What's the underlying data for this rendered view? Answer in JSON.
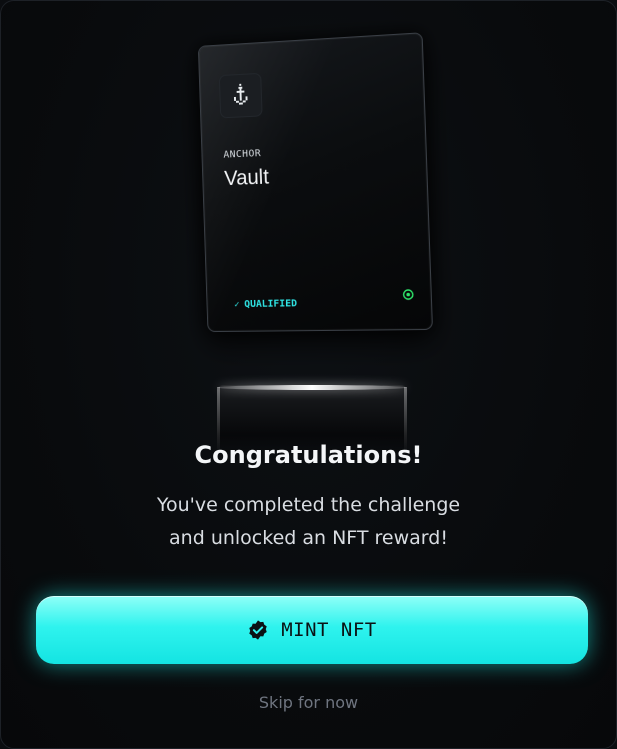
{
  "nft_card": {
    "subtitle": "ANCHOR",
    "title": "Vault",
    "status_check": "✓",
    "status_label": "QUALIFIED",
    "icon": "anchor-icon",
    "status_dot_color": "#2fe66b"
  },
  "dialog": {
    "headline": "Congratulations!",
    "message_line1": "You've completed the challenge",
    "message_line2": "and unlocked an NFT reward!"
  },
  "actions": {
    "mint_label": "MINT NFT",
    "mint_icon": "verified-badge-icon",
    "skip_label": "Skip for now"
  },
  "colors": {
    "accent": "#2ff3ee",
    "background": "#0b0d10"
  }
}
